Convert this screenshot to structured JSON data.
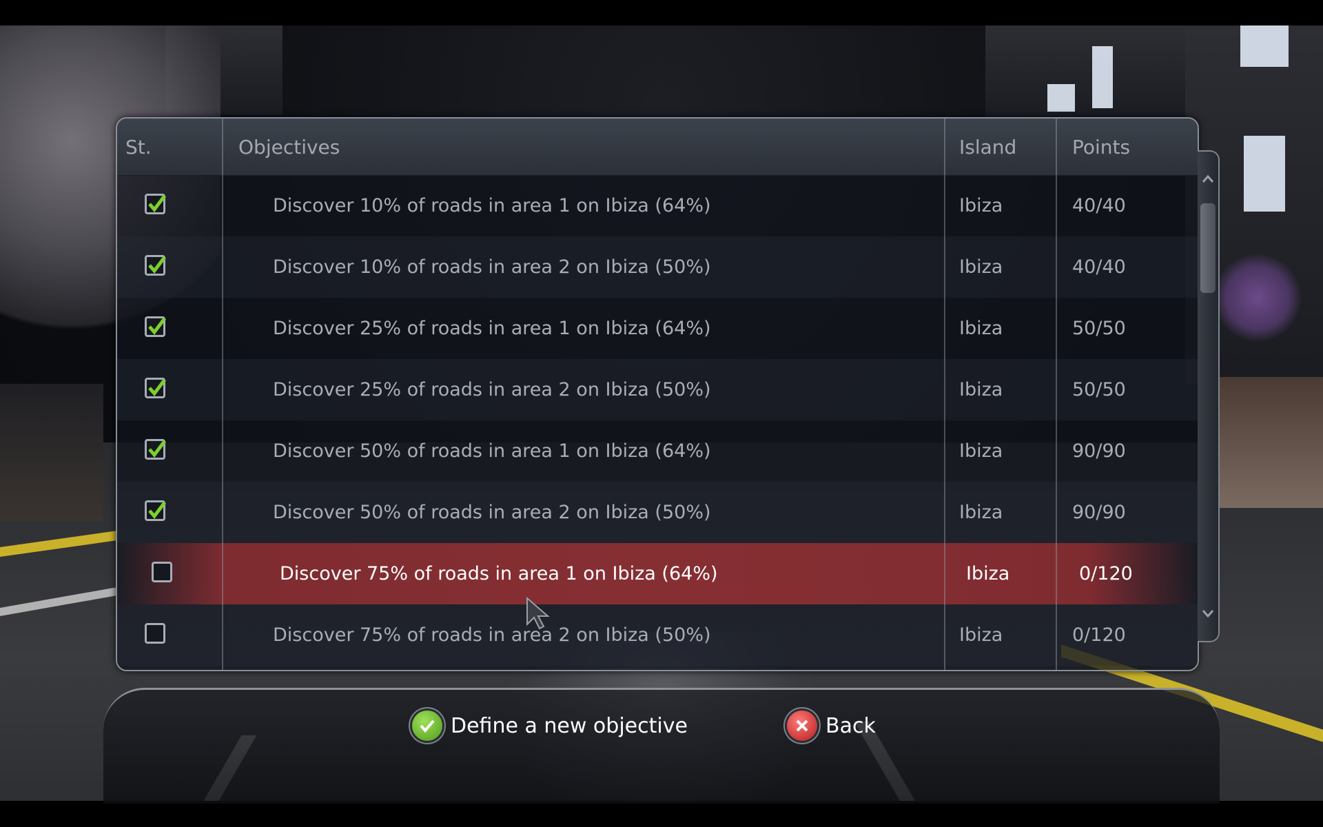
{
  "colors": {
    "check_green": "#7ccf2e",
    "selected_row": "#8c3034",
    "text_dim": "#a9aeb6",
    "text_bright": "#ffffff"
  },
  "table": {
    "headers": {
      "status": "St.",
      "objectives": "Objectives",
      "island": "Island",
      "points": "Points"
    },
    "rows": [
      {
        "done": true,
        "objective": "Discover 10% of roads in area 1 on Ibiza (64%)",
        "island": "Ibiza",
        "points": "40/40"
      },
      {
        "done": true,
        "objective": "Discover 10% of roads in area 2 on Ibiza (50%)",
        "island": "Ibiza",
        "points": "40/40"
      },
      {
        "done": true,
        "objective": "Discover 25% of roads in area 1 on Ibiza (64%)",
        "island": "Ibiza",
        "points": "50/50"
      },
      {
        "done": true,
        "objective": "Discover 25% of roads in area 2 on Ibiza (50%)",
        "island": "Ibiza",
        "points": "50/50"
      },
      {
        "done": true,
        "objective": "Discover 50% of roads in area 1 on Ibiza (64%)",
        "island": "Ibiza",
        "points": "90/90"
      },
      {
        "done": true,
        "objective": "Discover 50% of roads in area 2 on Ibiza (50%)",
        "island": "Ibiza",
        "points": "90/90"
      },
      {
        "done": false,
        "objective": "Discover 75% of roads in area 1 on Ibiza (64%)",
        "island": "Ibiza",
        "points": "0/120",
        "selected": true
      },
      {
        "done": false,
        "objective": "Discover 75% of roads in area 2 on Ibiza (50%)",
        "island": "Ibiza",
        "points": "0/120"
      }
    ]
  },
  "actions": {
    "define_label": "Define a new objective",
    "define_icon": "check-circle-icon",
    "back_label": "Back",
    "back_icon": "close-circle-icon"
  }
}
